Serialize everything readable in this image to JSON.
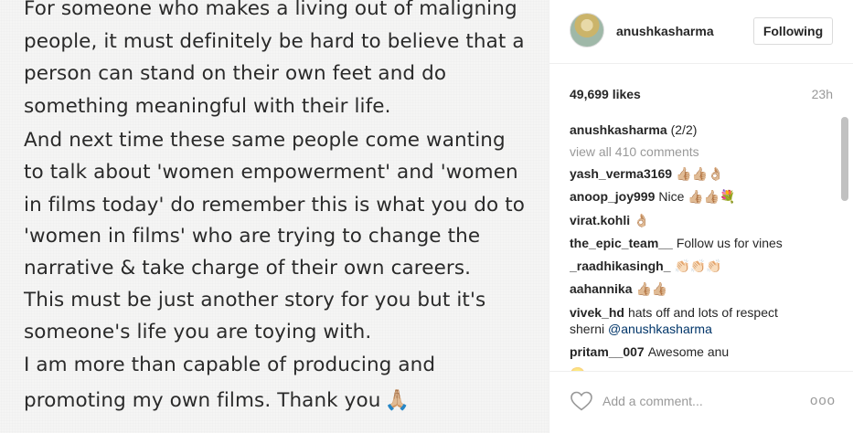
{
  "note": {
    "lines": [
      "For someone who makes a living out of maligning",
      "people, it must definitely be hard to believe that a",
      "person can stand on their own feet and do",
      "something meaningful with their life.",
      "And next time these same people come wanting",
      "to talk about 'women empowerment' and 'women",
      "in films today' do remember this is what you do to",
      "'women in films' who are trying to change the",
      "narrative & take charge of their own careers.",
      "This must be just another story for you but it's",
      "someone's life you are toying with.",
      "I am more than capable of producing and",
      "promoting my own films. Thank you"
    ],
    "emoji": "🙏🏼"
  },
  "post": {
    "username": "anushkasharma",
    "follow_label": "Following",
    "likes": "49,699 likes",
    "time": "23h"
  },
  "comments": {
    "caption_user": "anushkasharma",
    "caption_text": "(2/2)",
    "view_all": "view all 410 comments",
    "items": [
      {
        "user": "yash_verma3169",
        "text": "👍🏼👍🏼👌🏼"
      },
      {
        "user": "anoop_joy999",
        "text": "Nice 👍🏼👍🏼💐"
      },
      {
        "user": "virat.kohli",
        "text": "👌🏼"
      },
      {
        "user": "the_epic_team__",
        "text": "Follow us for vines"
      },
      {
        "user": "_raadhikasingh_",
        "text": "👏🏻👏🏻👏🏻"
      },
      {
        "user": "aahannika",
        "text": "👍🏼👍🏼"
      },
      {
        "user": "vivek_hd",
        "text": "hats off and lots of respect",
        "text2": "sherni",
        "mention": "@anushkasharma"
      },
      {
        "user": "pritam__007",
        "text": "Awesome anu"
      }
    ]
  },
  "footer": {
    "placeholder": "Add a comment...",
    "more": "ooo"
  },
  "icons": {
    "heart": "heart-icon",
    "more": "more-options-icon"
  }
}
